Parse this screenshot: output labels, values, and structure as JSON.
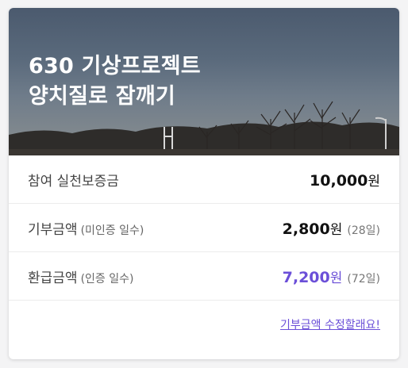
{
  "hero": {
    "title_line1": "630 기상프로젝트",
    "title_line2": "양치질로 잠깨기"
  },
  "rows": {
    "deposit": {
      "label": "참여 실천보증금",
      "amount": "10,000",
      "unit": "원"
    },
    "donation": {
      "label": "기부금액",
      "sub": "(미인증 일수)",
      "amount": "2,800",
      "unit": "원",
      "count": "(28일)"
    },
    "refund": {
      "label": "환급금액",
      "sub": "(인증 일수)",
      "amount": "7,200",
      "unit": "원",
      "count": "(72일)"
    }
  },
  "footer": {
    "edit_link": "기부금액 수정할래요!"
  },
  "colors": {
    "accent": "#6b4fd8"
  }
}
